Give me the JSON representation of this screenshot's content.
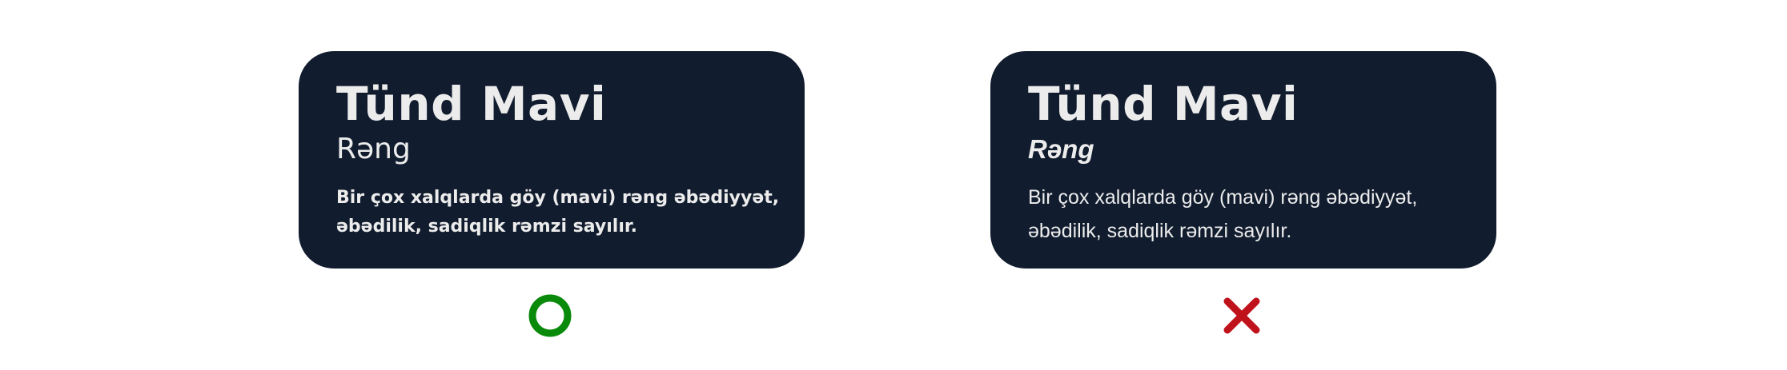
{
  "colors": {
    "card_background": "#111c2e",
    "card_text": "#ececec",
    "correct_mark": "#0a8a0a",
    "incorrect_mark": "#c0121b"
  },
  "cards": [
    {
      "title": "Tünd Mavi",
      "subtitle": "Rəng",
      "body_line_1": "Bir çox xalqlarda göy (mavi) rəng əbədiyyət,",
      "body_line_2": "əbədilik, sadiqlik rəmzi sayılır.",
      "verdict_icon": "circle-icon"
    },
    {
      "title": "Tünd Mavi",
      "subtitle": "Rəng",
      "body_line_1": "Bir çox xalqlarda göy (mavi) rəng əbədiyyət,",
      "body_line_2": "əbədilik, sadiqlik rəmzi sayılır.",
      "verdict_icon": "cross-icon"
    }
  ]
}
